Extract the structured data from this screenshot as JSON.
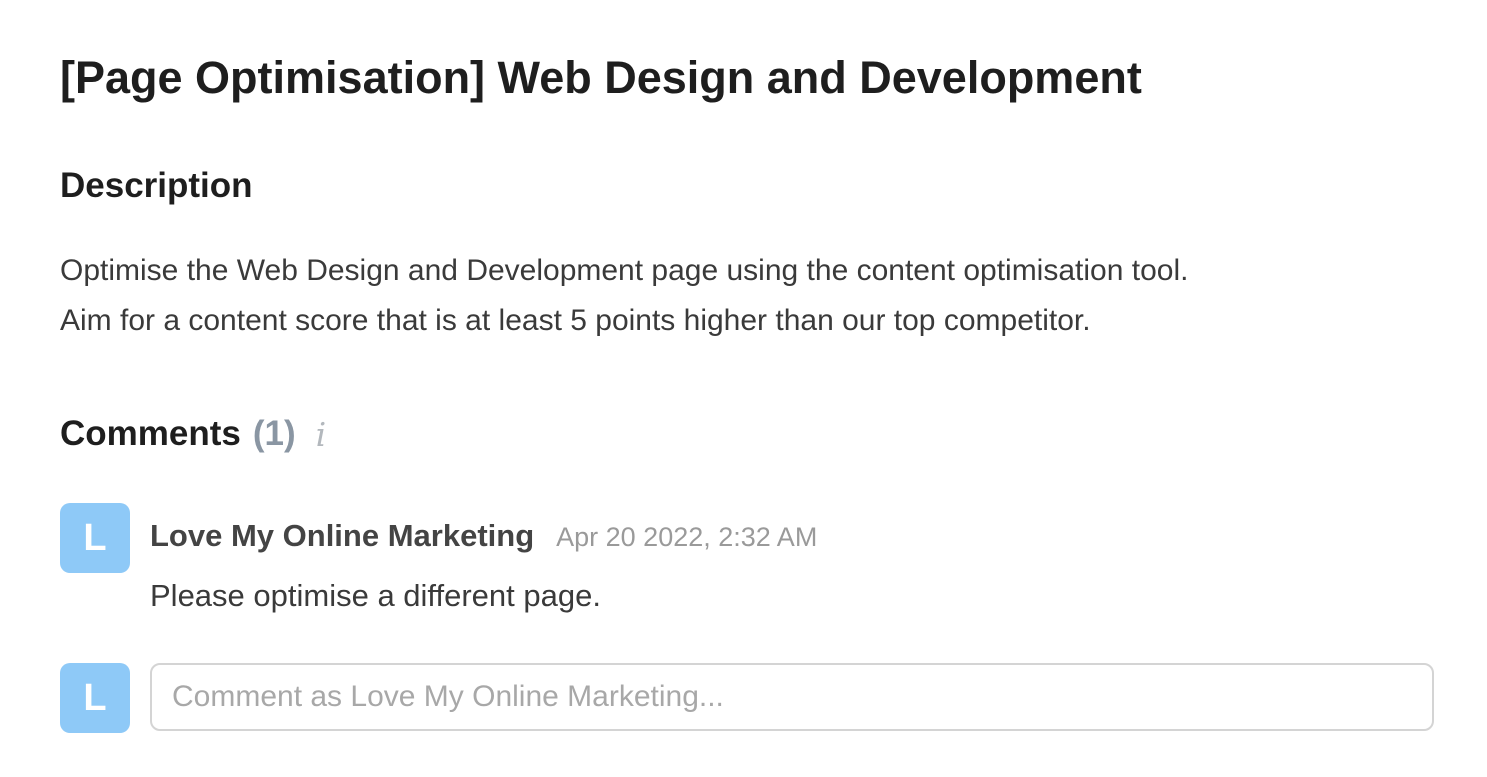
{
  "task": {
    "title": "[Page Optimisation] Web Design and Development"
  },
  "description": {
    "heading": "Description",
    "lines": [
      "Optimise the Web Design and Development page using the content optimisation tool.",
      "Aim for a content score that is at least 5 points higher than our top competitor."
    ]
  },
  "comments": {
    "heading": "Comments",
    "count": "(1)",
    "info_icon": "i",
    "items": [
      {
        "avatar_initial": "L",
        "author": "Love My Online Marketing",
        "timestamp": "Apr 20 2022, 2:32 AM",
        "body": "Please optimise a different page."
      }
    ],
    "composer": {
      "avatar_initial": "L",
      "placeholder": "Comment as Love My Online Marketing..."
    }
  },
  "colors": {
    "avatar_bg": "#8ec9f7",
    "count_text": "#8a96a3",
    "timestamp_text": "#9a9a9a"
  }
}
